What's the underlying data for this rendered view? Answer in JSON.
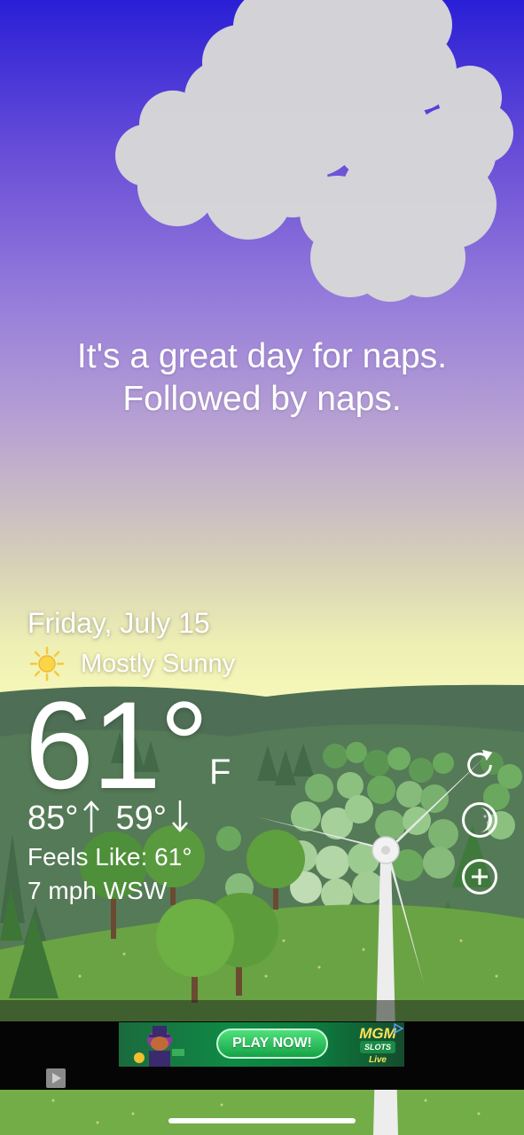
{
  "tagline": {
    "line1": "It's a great day for naps.",
    "line2": "Followed by naps."
  },
  "weather": {
    "date": "Friday, July 15",
    "condition": "Mostly Sunny",
    "condition_icon": "sun-icon",
    "temperature": "61°",
    "unit": "F",
    "high": "85°",
    "low": "59°",
    "feels_like": "Feels Like: 61°",
    "wind": "7 mph WSW"
  },
  "controls": {
    "refresh_icon": "refresh-icon",
    "moon_icon": "moon-phase-icon",
    "add_icon": "add-icon"
  },
  "ad": {
    "cta": "PLAY NOW!",
    "brand_line1": "MGM",
    "brand_line2": "SLOTS",
    "brand_line3": "Live"
  },
  "colors": {
    "sky_top": "#2a1fd6",
    "sky_bottom": "#f7f8b9",
    "hill_dark": "#4a6b52",
    "grass": "#6aa343"
  }
}
